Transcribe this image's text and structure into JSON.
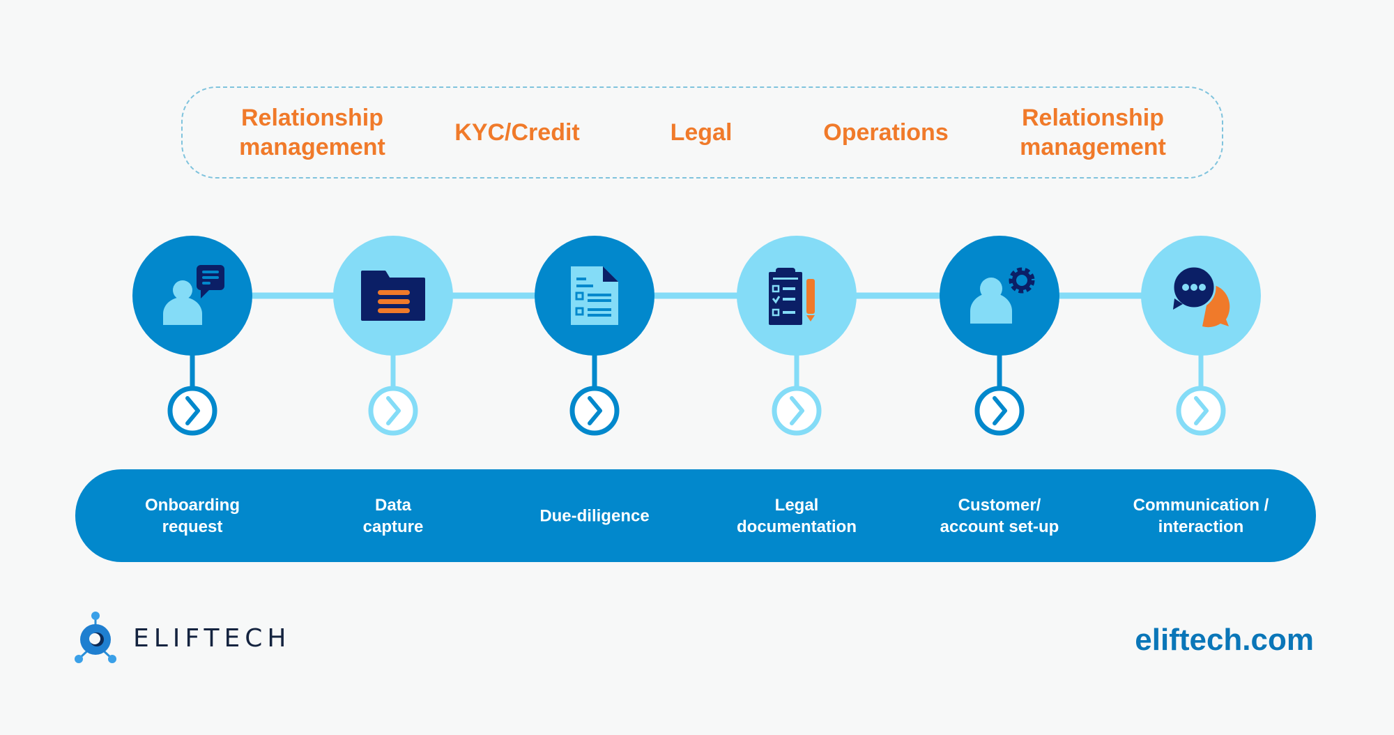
{
  "departments": [
    {
      "label": "Relationship\nmanagement"
    },
    {
      "label": "KYC/Credit"
    },
    {
      "label": "Legal"
    },
    {
      "label": "Operations"
    },
    {
      "label": "Relationship\nmanagement"
    }
  ],
  "steps": [
    {
      "label": "Onboarding\nrequest",
      "icon": "person-chat-icon",
      "tone": "dark"
    },
    {
      "label": "Data\ncapture",
      "icon": "folder-icon",
      "tone": "light"
    },
    {
      "label": "Due-diligence",
      "icon": "document-list-icon",
      "tone": "dark"
    },
    {
      "label": "Legal\ndocumentation",
      "icon": "clipboard-checklist-icon",
      "tone": "light"
    },
    {
      "label": "Customer/\naccount set-up",
      "icon": "person-gear-icon",
      "tone": "dark"
    },
    {
      "label": "Communication /\ninteraction",
      "icon": "speech-bubbles-icon",
      "tone": "light"
    }
  ],
  "brand": {
    "logo_text": "ELIFTECH",
    "website": "eliftech.com"
  },
  "colors": {
    "dark_blue": "#0288cc",
    "light_blue": "#84dcf7",
    "navy": "#0b1f66",
    "orange": "#f07a2a",
    "background": "#f7f8f8"
  }
}
